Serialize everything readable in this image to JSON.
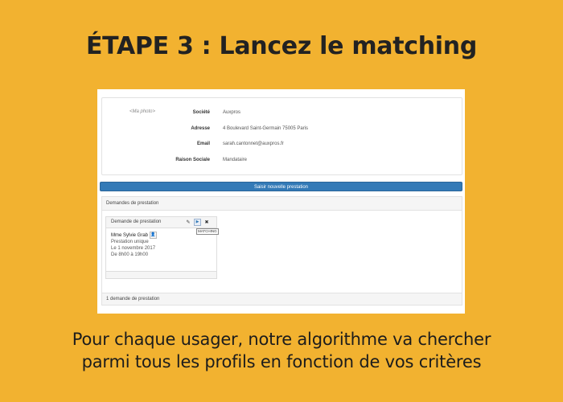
{
  "headline": "ÉTAPE 3 : Lancez le matching",
  "profile": {
    "photo_alt": "<Ma photo>",
    "fields": [
      {
        "label": "Société",
        "value": "Auxpros"
      },
      {
        "label": "Adresse",
        "value": "4 Boulevard Saint-Germain 75005 Paris"
      },
      {
        "label": "Email",
        "value": "sarah.cantonnet@auxpros.fr"
      },
      {
        "label": "Raison Sociale",
        "value": "Mandataire"
      }
    ]
  },
  "new_service_button": "Saisir nouvelle prestation",
  "requests_panel": {
    "title": "Demandes de prestation",
    "footer": "1 demande de prestation",
    "card": {
      "title": "Demande de prestation",
      "tooltip": "MATCHING",
      "client": "Mme Sylvie Grab",
      "type": "Prestation unique",
      "date": "Le 1 novembre 2017",
      "time": "De 8h00 à 19h00"
    }
  },
  "caption": {
    "line1": "Pour chaque usager, notre algorithme va chercher",
    "line2": "parmi tous les profils en fonction de vos critères"
  },
  "colors": {
    "background": "#f2b230",
    "primary_button": "#337ab7"
  },
  "icons": {
    "edit": "pencil-icon",
    "match": "play-icon",
    "delete": "close-icon",
    "user": "user-icon"
  }
}
